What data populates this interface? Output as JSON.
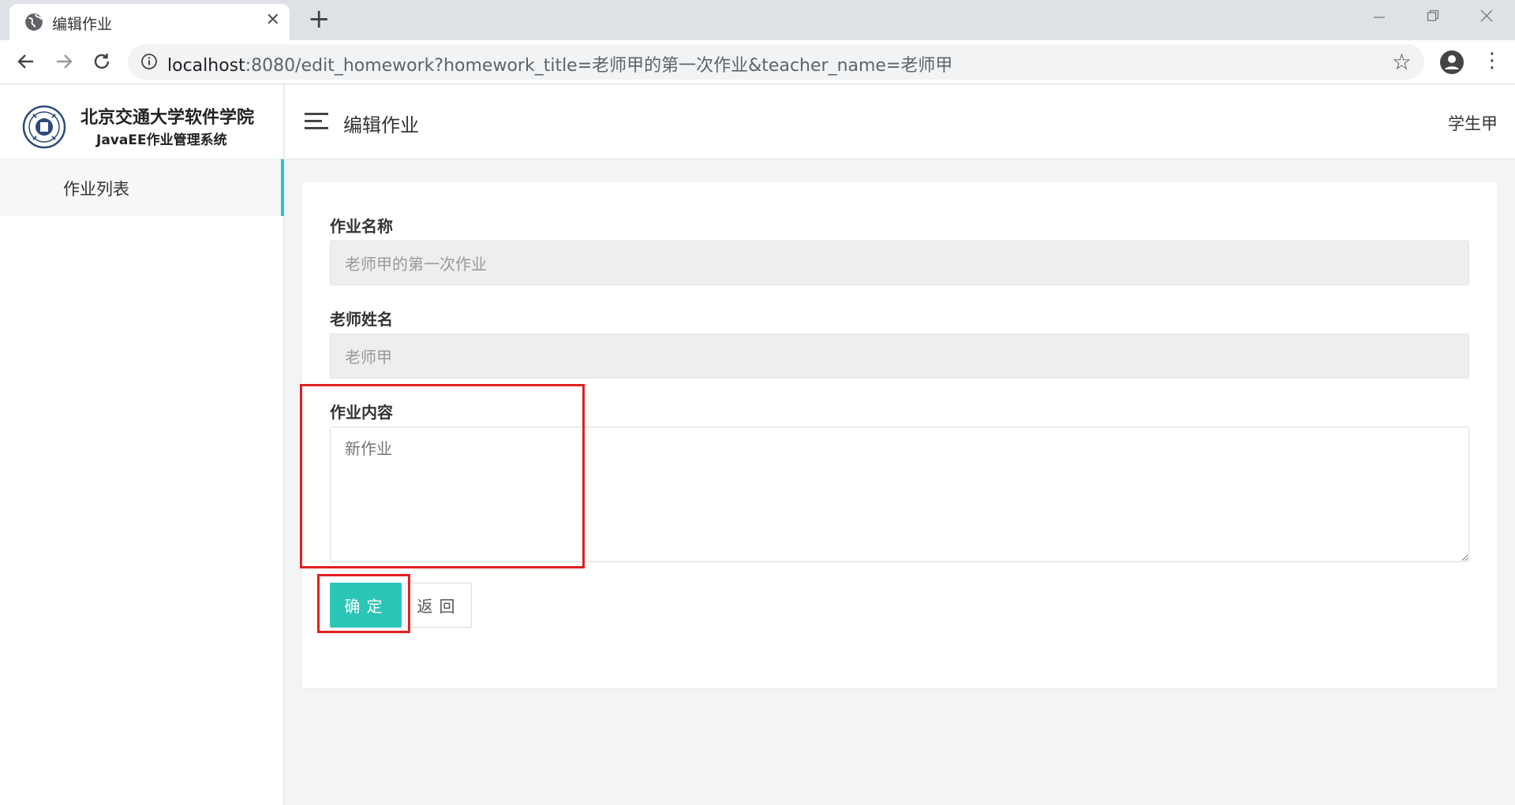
{
  "browser": {
    "tab_title": "编辑作业",
    "tab_close": "✕",
    "new_tab": "+",
    "url_host": "localhost",
    "url_rest": ":8080/edit_homework?homework_title=老师甲的第一次作业&teacher_name=老师甲",
    "icons": [
      "globe-icon",
      "back-icon",
      "forward-icon",
      "reload-icon",
      "info-icon",
      "star-icon",
      "account-icon",
      "menu-kebab-icon",
      "minimize-icon",
      "restore-icon",
      "close-icon"
    ]
  },
  "sidebar": {
    "brand_line1": "北京交通大学软件学院",
    "brand_line2": "JavaEE作业管理系统",
    "items": [
      {
        "label": "作业列表"
      }
    ],
    "accent": "#2bc6b7"
  },
  "header": {
    "title": "编辑作业",
    "user": "学生甲"
  },
  "form": {
    "homework_title_label": "作业名称",
    "homework_title_value": "老师甲的第一次作业",
    "teacher_name_label": "老师姓名",
    "teacher_name_value": "老师甲",
    "content_label": "作业内容",
    "content_placeholder": "新作业",
    "submit_label": "确定",
    "back_label": "返回"
  },
  "colors": {
    "primary": "#2bc6b7",
    "highlight": "#e02020"
  }
}
